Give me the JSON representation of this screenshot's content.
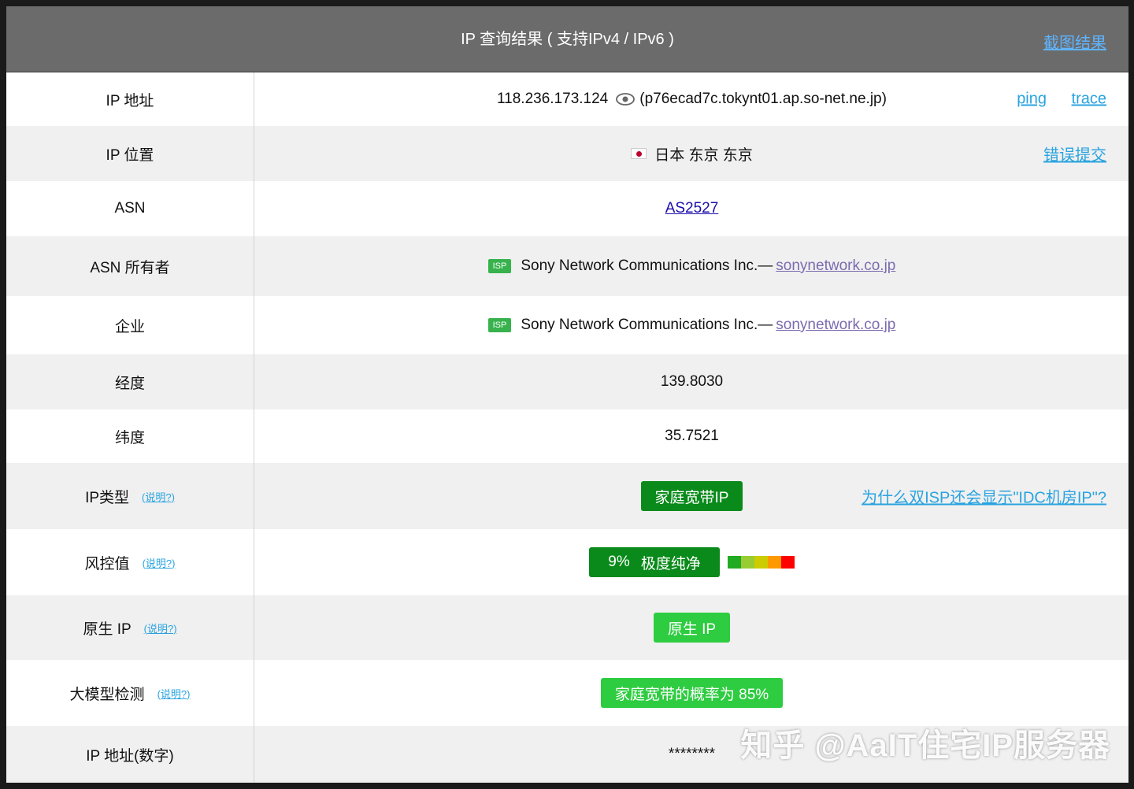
{
  "header": {
    "title": "IP 查询结果 ( 支持IPv4 / IPv6 )",
    "screenshot_link": "截图结果"
  },
  "rows": {
    "ip": {
      "label": "IP 地址",
      "address": "118.236.173.124",
      "hostname": "(p76ecad7c.tokynt01.ap.so-net.ne.jp)",
      "ping": "ping",
      "trace": "trace"
    },
    "location": {
      "label": "IP 位置",
      "value": "日本 东京 东京",
      "report": "错误提交"
    },
    "asn": {
      "label": "ASN",
      "value": "AS2527"
    },
    "asn_owner": {
      "label": "ASN 所有者",
      "badge": "ISP",
      "name": "Sony Network Communications Inc.—",
      "domain": "sonynetwork.co.jp"
    },
    "company": {
      "label": "企业",
      "badge": "ISP",
      "name": "Sony Network Communications Inc.—",
      "domain": "sonynetwork.co.jp"
    },
    "longitude": {
      "label": "经度",
      "value": "139.8030"
    },
    "latitude": {
      "label": "纬度",
      "value": "35.7521"
    },
    "ip_type": {
      "label": "IP类型",
      "explain": "(说明?)",
      "value": "家庭宽带IP",
      "faq": "为什么双ISP还会显示\"IDC机房IP\"?"
    },
    "risk": {
      "label": "风控值",
      "explain": "(说明?)",
      "percent": "9%",
      "level": "极度纯净",
      "scale_colors": [
        "#22aa22",
        "#99cc33",
        "#cccc00",
        "#ff9900",
        "#ff0000"
      ]
    },
    "native": {
      "label": "原生 IP",
      "explain": "(说明?)",
      "value": "原生 IP"
    },
    "ai_detect": {
      "label": "大模型检测",
      "explain": "(说明?)",
      "value": "家庭宽带的概率为 85%"
    },
    "ip_numeric": {
      "label": "IP 地址(数字)",
      "value": "********"
    }
  },
  "watermark": "知乎 @AaIT住宅IP服务器",
  "colors": {
    "header_bg": "#6b6b6b",
    "link": "#29a3e0",
    "pill_dark": "#0a8a1a",
    "pill_green": "#2ecc40"
  }
}
